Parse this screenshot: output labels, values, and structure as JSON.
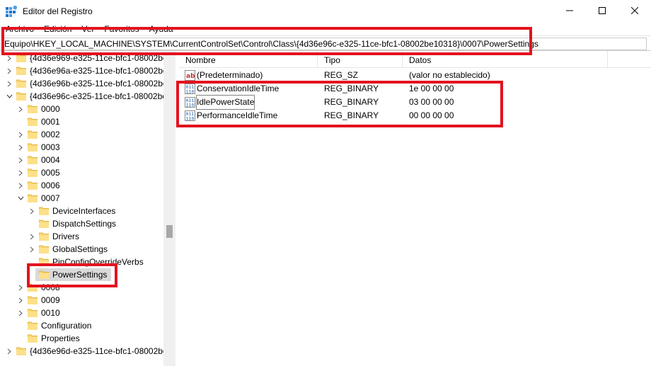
{
  "window": {
    "title": "Editor del Registro",
    "accent": "#e3131f"
  },
  "menu": [
    "Archivo",
    "Edición",
    "Ver",
    "Favoritos",
    "Ayuda"
  ],
  "address": {
    "path": "Equipo\\HKEY_LOCAL_MACHINE\\SYSTEM\\CurrentControlSet\\Control\\Class\\{4d36e96c-e325-11ce-bfc1-08002be10318}\\0007\\PowerSettings"
  },
  "tree": [
    {
      "label": "{4d36e969-e325-11ce-bfc1-08002be",
      "level": 1,
      "chevron": "right"
    },
    {
      "label": "{4d36e96a-e325-11ce-bfc1-08002be",
      "level": 1,
      "chevron": "right"
    },
    {
      "label": "{4d36e96b-e325-11ce-bfc1-08002be",
      "level": 1,
      "chevron": "right"
    },
    {
      "label": "{4d36e96c-e325-11ce-bfc1-08002be",
      "level": 1,
      "chevron": "down"
    },
    {
      "label": "0000",
      "level": 2,
      "chevron": "right"
    },
    {
      "label": "0001",
      "level": 2,
      "chevron": "none"
    },
    {
      "label": "0002",
      "level": 2,
      "chevron": "right"
    },
    {
      "label": "0003",
      "level": 2,
      "chevron": "right"
    },
    {
      "label": "0004",
      "level": 2,
      "chevron": "right"
    },
    {
      "label": "0005",
      "level": 2,
      "chevron": "right"
    },
    {
      "label": "0006",
      "level": 2,
      "chevron": "right"
    },
    {
      "label": "0007",
      "level": 2,
      "chevron": "down"
    },
    {
      "label": "DeviceInterfaces",
      "level": 3,
      "chevron": "right"
    },
    {
      "label": "DispatchSettings",
      "level": 3,
      "chevron": "none"
    },
    {
      "label": "Drivers",
      "level": 3,
      "chevron": "right"
    },
    {
      "label": "GlobalSettings",
      "level": 3,
      "chevron": "right"
    },
    {
      "label": "PinConfigOverrideVerbs",
      "level": 3,
      "chevron": "none"
    },
    {
      "label": "PowerSettings",
      "level": 3,
      "chevron": "none",
      "selected": true
    },
    {
      "label": "0008",
      "level": 2,
      "chevron": "right"
    },
    {
      "label": "0009",
      "level": 2,
      "chevron": "right"
    },
    {
      "label": "0010",
      "level": 2,
      "chevron": "right"
    },
    {
      "label": "Configuration",
      "level": 2,
      "chevron": "none"
    },
    {
      "label": "Properties",
      "level": 2,
      "chevron": "none"
    },
    {
      "label": "{4d36e96d-e325-11ce-bfc1-08002be",
      "level": 1,
      "chevron": "right"
    }
  ],
  "columns": {
    "name": "Nombre",
    "type": "Tipo",
    "data": "Datos"
  },
  "values": [
    {
      "name": "(Predeterminado)",
      "type": "REG_SZ",
      "data": "(valor no establecido)",
      "icon": "string-value-icon"
    },
    {
      "name": "ConservationIdleTime",
      "type": "REG_BINARY",
      "data": "1e 00 00 00",
      "icon": "binary-value-icon"
    },
    {
      "name": "IdlePowerState",
      "type": "REG_BINARY",
      "data": "03 00 00 00",
      "icon": "binary-value-icon"
    },
    {
      "name": "PerformanceIdleTime",
      "type": "REG_BINARY",
      "data": "00 00 00 00",
      "icon": "binary-value-icon"
    }
  ]
}
